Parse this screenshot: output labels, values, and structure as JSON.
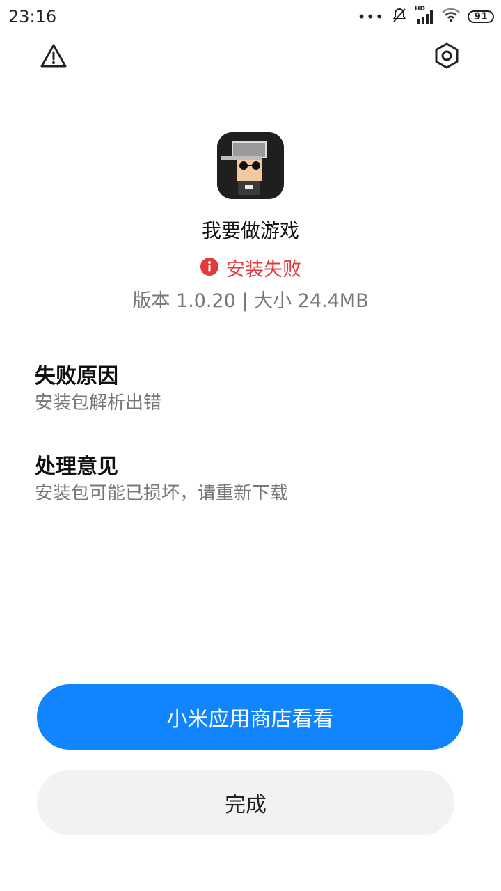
{
  "status_bar": {
    "time": "23:16",
    "dots": "•••",
    "signal_label": "HD",
    "battery": "91",
    "icons": [
      "bell-off-icon",
      "signal-icon",
      "wifi-icon",
      "battery-icon"
    ]
  },
  "top_bar": {
    "left_icon": "warning-icon",
    "right_icon": "settings-icon"
  },
  "app": {
    "icon": "game-app-icon",
    "name": "我要做游戏",
    "status": "安装失败",
    "status_color": "#e5393a",
    "meta": "版本 1.0.20 | 大小 24.4MB"
  },
  "reason": {
    "title": "失败原因",
    "body": "安装包解析出错"
  },
  "suggestion": {
    "title": "处理意见",
    "body": "安装包可能已损坏，请重新下载"
  },
  "buttons": {
    "primary": "小米应用商店看看",
    "secondary": "完成"
  },
  "colors": {
    "accent": "#1185fe",
    "error": "#e5393a"
  }
}
